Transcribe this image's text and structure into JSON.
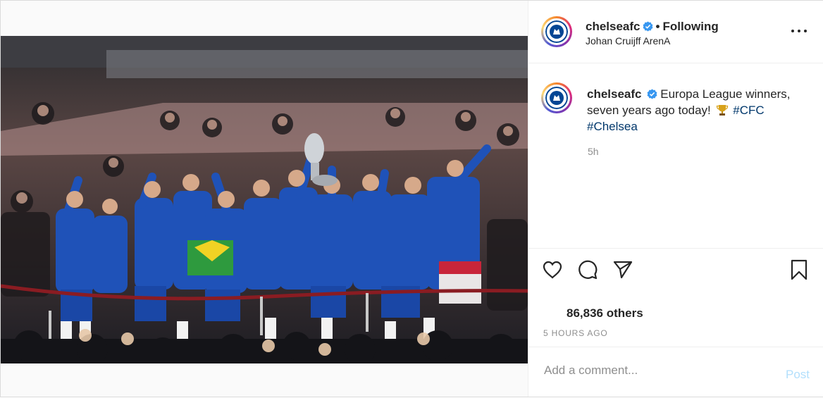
{
  "post": {
    "username": "chelseafc",
    "separator": "•",
    "follow_status": "Following",
    "location": "Johan Cruijff ArenA",
    "caption_text": "Europa League winners, seven years ago today!",
    "hashtags": [
      "#CFC",
      "#Chelsea"
    ],
    "time_ago": "5h",
    "likes_text": "86,836 others",
    "posted_ago": "5 HOURS AGO",
    "comment_placeholder": "Add a comment...",
    "post_button": "Post"
  },
  "photo": {
    "description_icon": "team-celebration-photo"
  },
  "icons": {
    "more": "more-options-icon",
    "like": "heart-icon",
    "comment": "comment-icon",
    "share": "paper-plane-icon",
    "save": "bookmark-icon",
    "verified": "verified-badge-icon",
    "caption_emoji": "trophy-icon"
  },
  "colors": {
    "verified_blue": "#3897f0",
    "link": "#00376b",
    "muted": "#8e8e8e",
    "post_disabled": "#b2dffc",
    "chelsea_blue": "#034694"
  }
}
